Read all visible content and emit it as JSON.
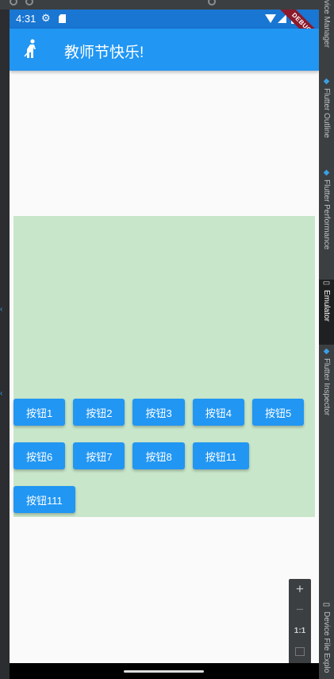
{
  "statusbar": {
    "time": "4:31",
    "debug_banner": "DEBUG"
  },
  "appbar": {
    "title": "教师节快乐!",
    "icon": "person-icon"
  },
  "buttons": [
    "按钮1",
    "按钮2",
    "按钮3",
    "按钮4",
    "按钮5",
    "按钮6",
    "按钮7",
    "按钮8",
    "按钮11",
    "按钮111"
  ],
  "ide": {
    "tabs": [
      "vice Manager",
      "Flutter Outline",
      "Flutter Performance",
      "Emulator",
      "Flutter Inspector",
      "Device File Explo"
    ]
  },
  "zoom_controls": {
    "plus": "+",
    "minus": "−",
    "one_to_one": "1:1"
  },
  "colors": {
    "primary": "#2196f3",
    "status_bar": "#1976d2",
    "container": "#c8e6c9",
    "background": "#fafafa"
  }
}
